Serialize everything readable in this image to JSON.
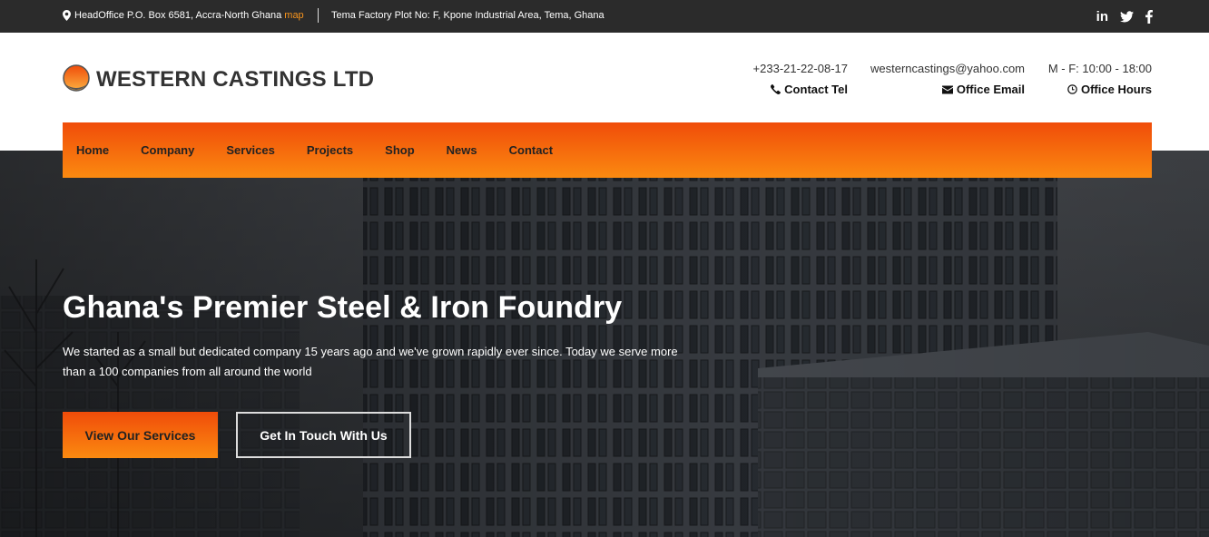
{
  "topbar": {
    "address": "HeadOffice P.O. Box 6581, Accra-North Ghana",
    "map_link": "map",
    "factory": "Tema Factory Plot No: F, Kpone Industrial Area, Tema, Ghana",
    "socials": [
      "linkedin-icon",
      "twitter-icon",
      "facebook-icon"
    ]
  },
  "brand": {
    "name": "WESTERN CASTINGS LTD"
  },
  "contacts": {
    "tel_value": "+233-21-22-08-17",
    "tel_label": "Contact Tel",
    "email_value": "westerncastings@yahoo.com",
    "email_label": "Office Email",
    "hours_value": "M - F: 10:00 - 18:00",
    "hours_label": "Office Hours"
  },
  "nav": {
    "items": [
      "Home",
      "Company",
      "Services",
      "Projects",
      "Shop",
      "News",
      "Contact"
    ]
  },
  "hero": {
    "title": "Ghana's Premier Steel & Iron Foundry",
    "text": "We started as a small but dedicated company 15 years ago and we've grown rapidly ever since. Today we serve more than a 100 companies from all around the world",
    "primary_button": "View Our Services",
    "secondary_button": "Get In Touch With Us"
  },
  "colors": {
    "accent_start": "#f04c0a",
    "accent_end": "#fb8a10",
    "topbar_bg": "#2b2b2b",
    "map_link": "#f7941d"
  }
}
